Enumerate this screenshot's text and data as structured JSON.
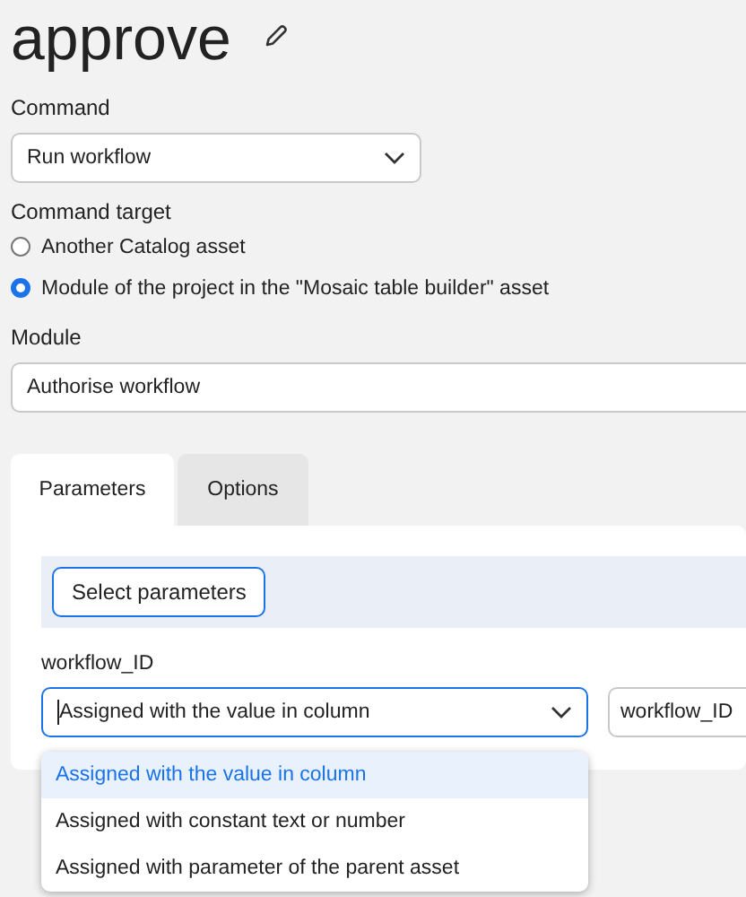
{
  "title": "approve",
  "command": {
    "label": "Command",
    "value": "Run workflow"
  },
  "command_target": {
    "label": "Command target",
    "options": [
      {
        "label": "Another Catalog asset",
        "selected": false
      },
      {
        "label": "Module of the project in the \"Mosaic table builder\" asset",
        "selected": true
      }
    ]
  },
  "module": {
    "label": "Module",
    "value": "Authorise workflow"
  },
  "tabs": [
    {
      "label": "Parameters",
      "selected": true
    },
    {
      "label": "Options",
      "selected": false
    }
  ],
  "select_button": "Select parameters",
  "parameter": {
    "label": "workflow_ID",
    "mode": "Assigned with the value in column",
    "focused": true,
    "column": "workflow_ID"
  },
  "dropdown": [
    {
      "label": "Assigned with the value in column",
      "selected": true
    },
    {
      "label": "Assigned with constant text or number",
      "selected": false
    },
    {
      "label": "Assigned with parameter of the parent asset",
      "selected": false
    }
  ]
}
